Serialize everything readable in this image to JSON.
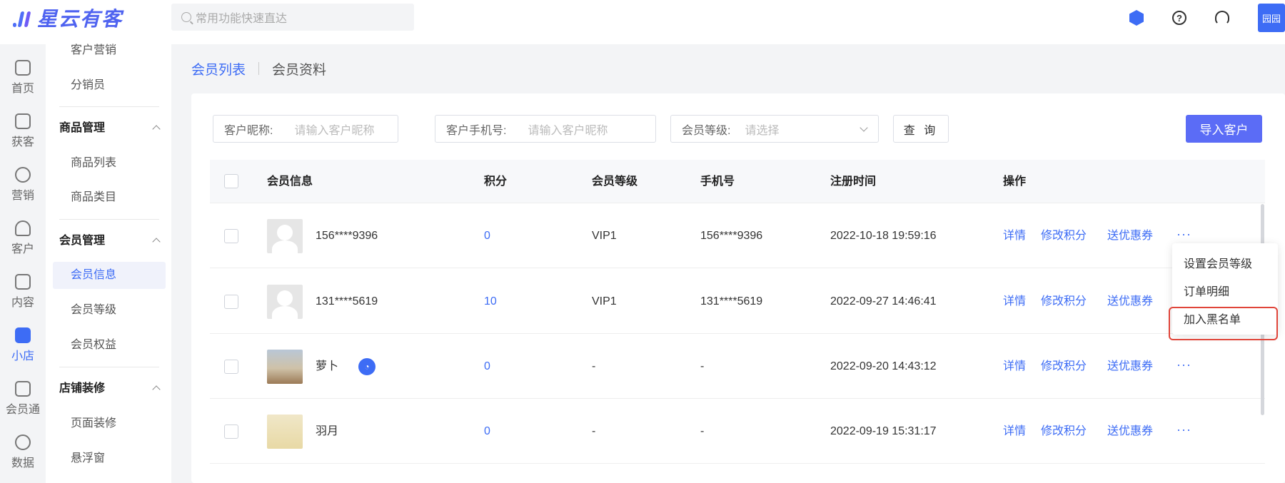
{
  "header": {
    "logo_text": "星云有客",
    "search_placeholder": "常用功能快速直达",
    "avatar_text": "园园",
    "icons": [
      "hexagon-brand-icon",
      "help-icon",
      "headset-icon"
    ]
  },
  "rail": {
    "items": [
      {
        "label": "首页",
        "icon": "home-icon"
      },
      {
        "label": "获客",
        "icon": "user-add-icon"
      },
      {
        "label": "营销",
        "icon": "bulb-icon"
      },
      {
        "label": "客户",
        "icon": "user-icon"
      },
      {
        "label": "内容",
        "icon": "folder-icon"
      },
      {
        "label": "小店",
        "icon": "shop-icon"
      },
      {
        "label": "会员通",
        "icon": "crown-icon"
      },
      {
        "label": "数据",
        "icon": "pie-icon"
      }
    ],
    "active": "小店"
  },
  "menu": {
    "top_items": [
      "客户营销",
      "分销员"
    ],
    "groups": [
      {
        "title": "商品管理",
        "items": [
          "商品列表",
          "商品类目"
        ]
      },
      {
        "title": "会员管理",
        "items": [
          "会员信息",
          "会员等级",
          "会员权益"
        ]
      },
      {
        "title": "店铺装修",
        "items": [
          "页面装修",
          "悬浮窗"
        ]
      }
    ],
    "active": "会员信息"
  },
  "tabs": [
    "会员列表",
    "会员资料"
  ],
  "filters": {
    "nickname_label": "客户昵称:",
    "nickname_placeholder": "请输入客户昵称",
    "phone_label": "客户手机号:",
    "phone_placeholder": "请输入客户昵称",
    "level_label": "会员等级:",
    "level_placeholder": "请选择",
    "query_button": "查 询",
    "import_button": "导入客户"
  },
  "table": {
    "headers": [
      "会员信息",
      "积分",
      "会员等级",
      "手机号",
      "注册时间",
      "操作"
    ],
    "rows": [
      {
        "name": "156****9396",
        "points": "0",
        "level": "VIP1",
        "phone": "156****9396",
        "registered": "2022-10-18 19:59:16"
      },
      {
        "name": "131****5619",
        "points": "10",
        "level": "VIP1",
        "phone": "131****5619",
        "registered": "2022-09-27 14:46:41"
      },
      {
        "name": "萝卜",
        "points": "0",
        "level": "-",
        "phone": "-",
        "registered": "2022-09-20 14:43:12"
      },
      {
        "name": "羽月",
        "points": "0",
        "level": "-",
        "phone": "-",
        "registered": "2022-09-19 15:31:17"
      }
    ],
    "actions": [
      "详情",
      "修改积分",
      "送优惠券"
    ],
    "more": "···"
  },
  "dropdown": {
    "items": [
      "设置会员等级",
      "订单明细",
      "加入黑名单"
    ],
    "highlighted": "加入黑名单"
  }
}
